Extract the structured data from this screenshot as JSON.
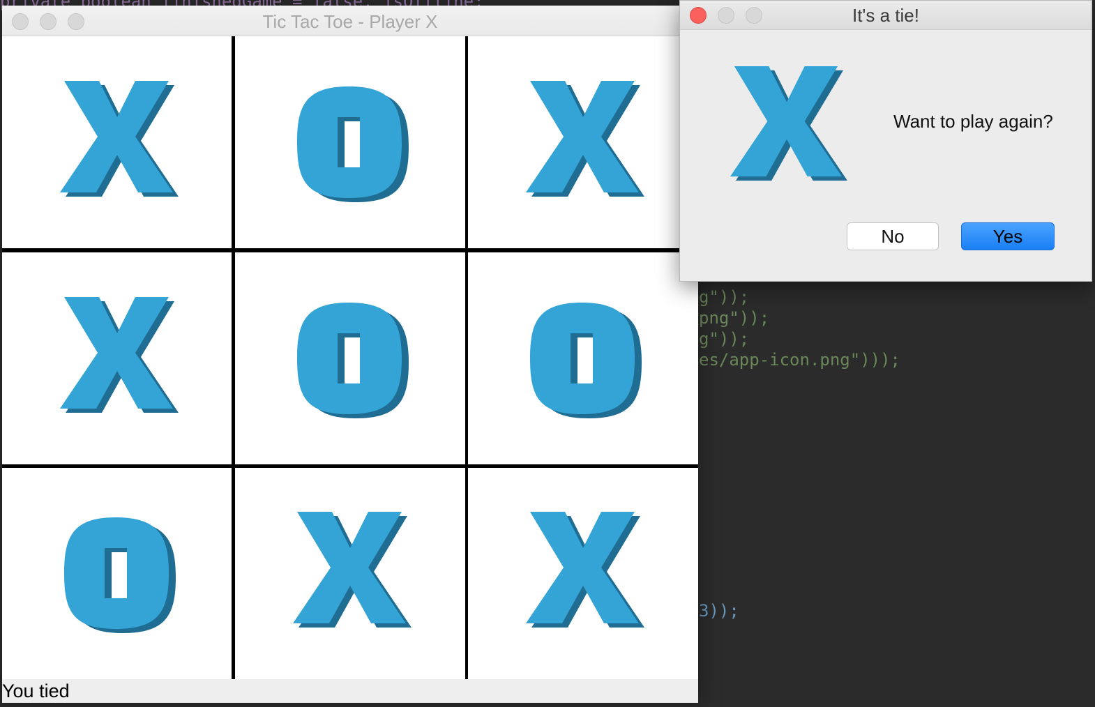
{
  "background_editor": {
    "top_line": "private boolean finishedGame = false, isOffline;",
    "lines": [
      {
        "text": "g\"));"
      },
      {
        "text": "png\"));"
      },
      {
        "text": "g\"));"
      },
      {
        "text": "es/app-icon.png\")));"
      },
      {
        "text": "3));"
      }
    ]
  },
  "game_window": {
    "title": "Tic Tac Toe - Player X",
    "board": [
      [
        "X",
        "O",
        "X"
      ],
      [
        "X",
        "O",
        "O"
      ],
      [
        "O",
        "X",
        "X"
      ]
    ],
    "status": "You tied"
  },
  "dialog": {
    "title": "It's a tie!",
    "icon": "x-piece-icon",
    "message": "Want to play again?",
    "buttons": {
      "no": "No",
      "yes": "Yes"
    }
  },
  "colors": {
    "piece_front": "#34a4d6",
    "piece_side": "#1f6d93",
    "yes_button": "#1a7ff5",
    "close_button": "#fc605c"
  }
}
